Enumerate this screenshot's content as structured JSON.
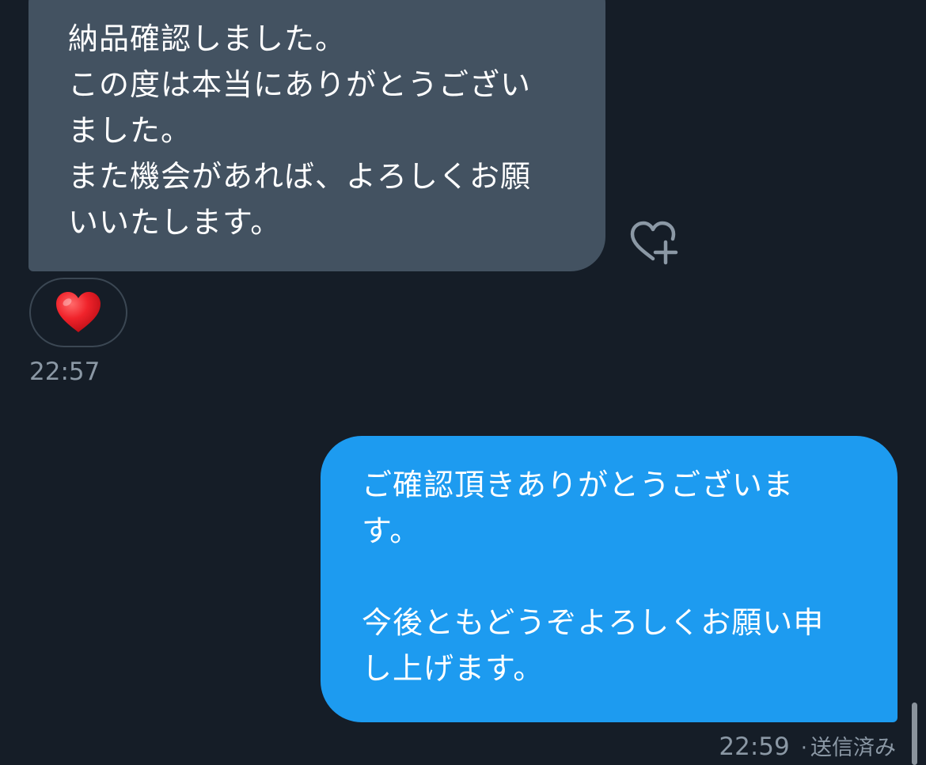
{
  "conversation": {
    "received": {
      "lines": [
        "納品確認しました。",
        "この度は本当にありがとうござい",
        "ました。",
        "また機会があれば、よろしくお願",
        "いいたします。"
      ],
      "reaction_emoji": "heart",
      "time": "22:57"
    },
    "sent": {
      "lines": [
        "ご確認頂きありがとうございま",
        "す。",
        "",
        "今後ともどうぞよろしくお願い申",
        "し上げます。"
      ],
      "time": "22:59",
      "separator": "·",
      "status": "送信済み"
    }
  },
  "icons": {
    "add_reaction": "heart-plus-icon",
    "reaction": "red-heart-icon"
  },
  "colors": {
    "background": "#151d27",
    "received_bubble": "#435261",
    "sent_bubble": "#1d9bf0",
    "timestamp": "#8b98a5",
    "reaction_heart": "#e0161e"
  }
}
